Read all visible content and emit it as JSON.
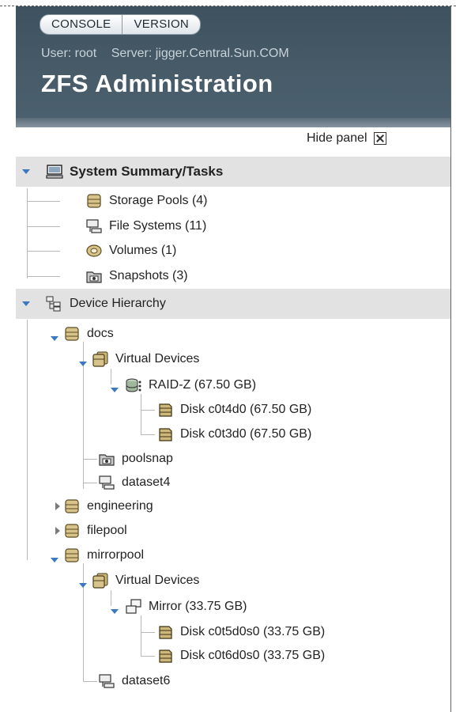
{
  "masthead": {
    "tabs": [
      "CONSOLE",
      "VERSION"
    ],
    "user": "User: root",
    "server": "Server: jigger.Central.Sun.COM",
    "title": "ZFS Administration"
  },
  "panel": {
    "hide_label": "Hide panel"
  },
  "tree": {
    "summary": {
      "label": "System Summary/Tasks",
      "items": [
        "Storage Pools (4)",
        "File Systems (11)",
        "Volumes (1)",
        "Snapshots (3)"
      ]
    },
    "hierarchy": {
      "label": "Device Hierarchy",
      "docs": "docs",
      "docs_vdevs": "Virtual Devices",
      "raidz": "RAID-Z (67.50 GB)",
      "disk1": "Disk c0t4d0 (67.50 GB)",
      "disk2": "Disk c0t3d0 (67.50 GB)",
      "poolsnap": "poolsnap",
      "dataset4": "dataset4",
      "engineering": "engineering",
      "filepool": "filepool",
      "mirrorpool": "mirrorpool",
      "mirror_vdevs": "Virtual Devices",
      "mirror": "Mirror (33.75 GB)",
      "disk3": "Disk c0t5d0s0 (33.75 GB)",
      "disk4": "Disk c0t6d0s0 (33.75 GB)",
      "dataset6": "dataset6"
    }
  }
}
